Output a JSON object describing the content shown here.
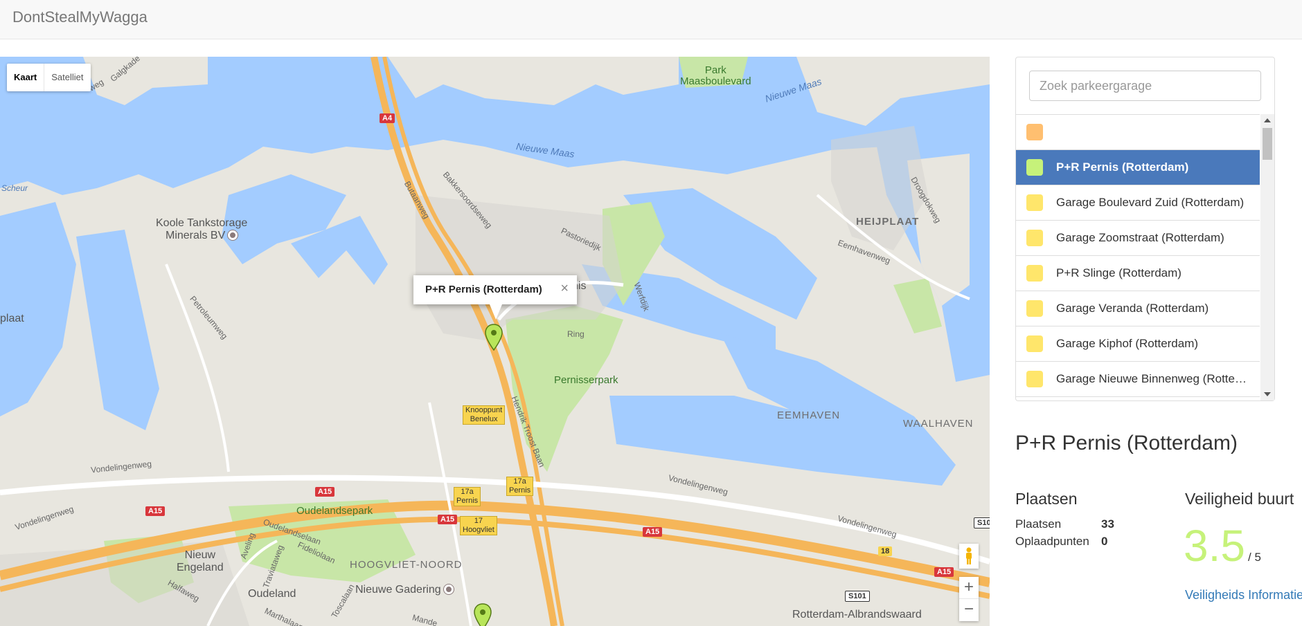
{
  "app": {
    "title": "DontStealMyWagga"
  },
  "map": {
    "map_types": [
      "Kaart",
      "Satelliet"
    ],
    "active_map_type": "Kaart",
    "info_window": {
      "title": "P+R Pernis (Rotterdam)",
      "close": "×"
    },
    "zoom_in": "+",
    "zoom_out": "−",
    "labels": {
      "park_maasboulevard": "Park\nMaasboulevard",
      "nieuwe_maas_1": "Nieuwe Maas",
      "nieuwe_maas_2": "Nieuwe Maas",
      "scheur": "Scheur",
      "koole": "Koole Tankstorage\nMinerals BV",
      "plaat": "plaat",
      "heijplaat": "HEIJPLAAT",
      "eemhavenweg": "Eemhavenweg",
      "droogdokweg": "Droogdokweg",
      "pastoriedijk": "Pastoriedijk",
      "bakkersoordseweg": "Bakkersoordseweg",
      "butaanweg": "Butaanweg",
      "petroleumweg": "Petroleumweg",
      "ring": "Ring",
      "werfdijk": "Werfdijk",
      "pernisserpark": "Pernisserpark",
      "pernis_partial": "nis",
      "hendrik_troost_baan": "Hendrik Troost Baan",
      "eemhaven": "EEMHAVEN",
      "waalhaven": "WAALHAVEN",
      "vondelingenweg_1": "Vondelingenweg",
      "vondelingenweg_2": "Vondelingenweg",
      "vondelingenweg_3": "Vondelingenweg",
      "vondelingenweg_4": "Vondelingenweg",
      "oudelandsepark": "Oudelandsepark",
      "nieuw_engeland": "Nieuw\nEngeland",
      "oudeland": "Oudeland",
      "hoogvliet_noord": "HOOGVLIET-NOORD",
      "nieuwe_gadering": "Nieuwe Gadering",
      "rotterdam_albrandswaard": "Rotterdam-Albrandswaard",
      "oudelandselaan": "Oudelandselaan",
      "fideliolaan": "Fideliolaan",
      "aveling": "Aveling",
      "traviataweg": "Traviataweg",
      "halfaweg": "Halfaweg",
      "marthalaan": "Marthalaan",
      "toscalaan": "Toscalaan",
      "galgkade": "Galgkade",
      "weg": "weg",
      "mande": "Mande"
    },
    "shields": {
      "a4": "A4",
      "a15_1": "A15",
      "a15_2": "A15",
      "a15_3": "A15",
      "a15_4": "A15",
      "a15_5": "A15",
      "s101": "S101",
      "s10": "S10",
      "n18": "18"
    },
    "exits": {
      "knooppunt": "Knooppunt\nBenelux",
      "e17a_1": "17a\nPernis",
      "e17a_2": "17a\nPernis",
      "e17": "17\nHoogvliet"
    }
  },
  "sidebar": {
    "search_placeholder": "Zoek parkeergarage",
    "items": [
      {
        "label": "",
        "color": "#ffbf70"
      },
      {
        "label": "P+R Pernis (Rotterdam)",
        "color": "#c6f27a",
        "active": true
      },
      {
        "label": "Garage Boulevard Zuid (Rotterdam)",
        "color": "#ffe66b"
      },
      {
        "label": "Garage Zoomstraat (Rotterdam)",
        "color": "#ffe66b"
      },
      {
        "label": "P+R Slinge (Rotterdam)",
        "color": "#ffe66b"
      },
      {
        "label": "Garage Veranda (Rotterdam)",
        "color": "#ffe66b"
      },
      {
        "label": "Garage Kiphof (Rotterdam)",
        "color": "#ffe66b"
      },
      {
        "label": "Garage Nieuwe Binnenweg (Rotterdam)",
        "color": "#ffe66b"
      }
    ]
  },
  "detail": {
    "title": "P+R Pernis (Rotterdam)",
    "places_heading": "Plaatsen",
    "safety_heading": "Veiligheid buurt",
    "spots_label": "Plaatsen",
    "spots_value": "33",
    "chargers_label": "Oplaadpunten",
    "chargers_value": "0",
    "score": "3.5",
    "score_max": "/ 5",
    "safety_link": "Veiligheids Informatie"
  }
}
